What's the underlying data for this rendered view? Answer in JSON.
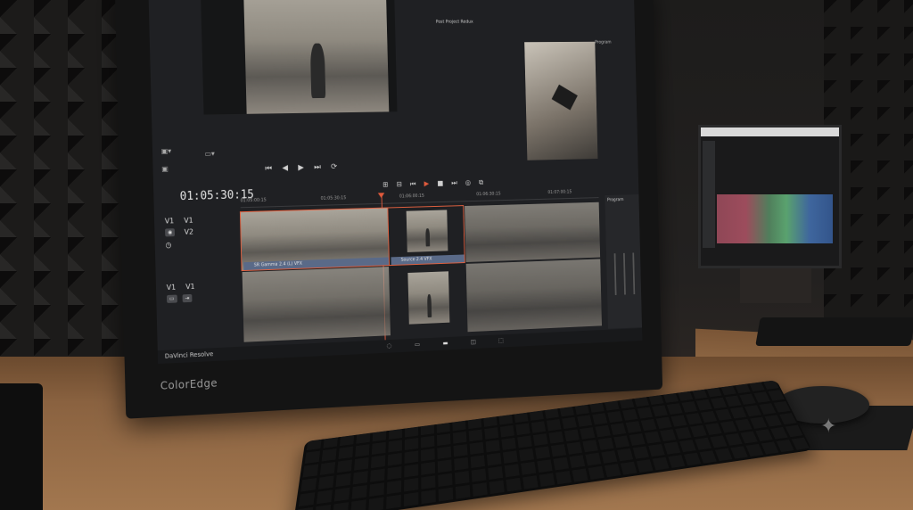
{
  "scene": "video editing workstation photo",
  "monitor": {
    "brand": "ColorEdge",
    "app_name": "DaVinci Resolve",
    "project_title": "Post Project Redux",
    "right_label": "Program",
    "timecode": "01:05:30:15",
    "ruler_ticks": [
      "01:05:00:15",
      "01:05:30:15",
      "01:06:00:15",
      "01:06:30:15",
      "01:07:00:15"
    ],
    "tracks": {
      "top_v1": "V1",
      "top_v1b": "V1",
      "top_v2": "V2",
      "bottom_v1": "V1",
      "bottom_v1b": "V1"
    },
    "clip_names": [
      "SR Gamma 2.4 (L) VFX",
      "Source 2.4 VFX"
    ],
    "inspector_title": "Program"
  }
}
